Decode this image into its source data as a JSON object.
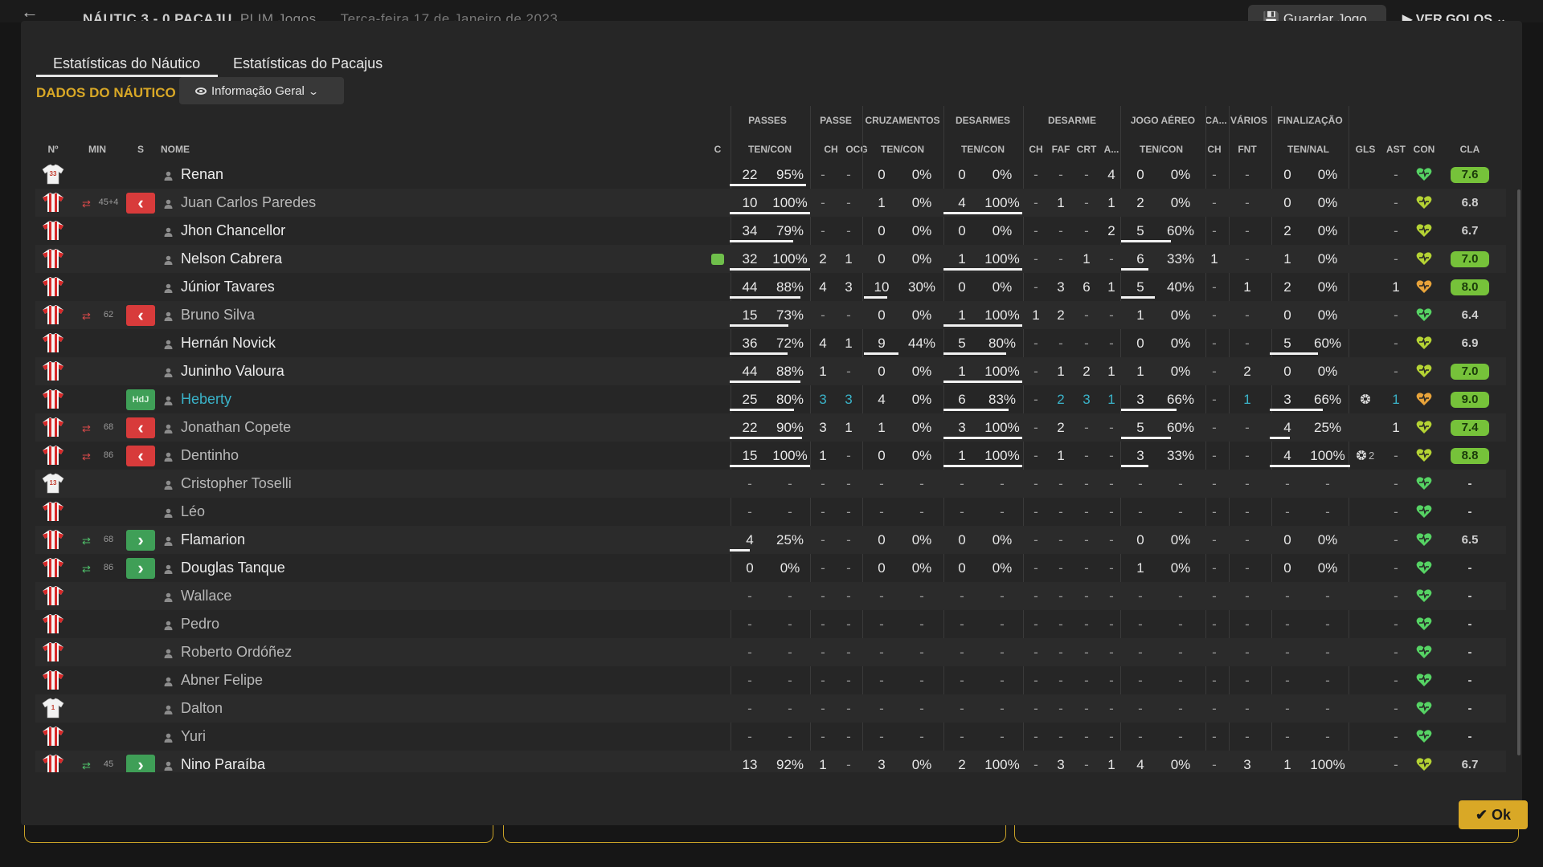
{
  "header": {
    "match": "NÁUTIC 3 - 0 PACAJU",
    "competition": "PLIM Jogos",
    "date": "Terça-feira 17 de Janeiro de 2023",
    "save_label": "Guardar Jogo",
    "goals_label": "VER GOLOS"
  },
  "tabs": [
    {
      "label": "Estatísticas do Náutico",
      "active": true
    },
    {
      "label": "Estatísticas do Pacajus",
      "active": false
    }
  ],
  "section_title": "DADOS DO NÁUTICO",
  "view_selector": "Informação Geral",
  "group_headers": [
    "PASSES",
    "PASSE",
    "CRUZAMENTOS",
    "DESARMES",
    "DESARME",
    "JOGO AÉREO",
    "CA...",
    "VÁRIOS",
    "FINALIZAÇÃO"
  ],
  "col_headers": {
    "num": "Nº",
    "min": "MIN",
    "s": "S",
    "name": "NOME",
    "c": "C",
    "passes": "TEN/CON",
    "pch": "CH",
    "pocg": "OCG",
    "cruz": "TEN/CON",
    "des": "TEN/CON",
    "dch": "CH",
    "dfaf": "FAF",
    "dcrt": "CRT",
    "da": "A...",
    "air": "TEN/CON",
    "cach": "CH",
    "fnt": "FNT",
    "fin": "TEN/NAL",
    "gls": "GLS",
    "ast": "AST",
    "con": "CON",
    "cla": "CLA"
  },
  "players": [
    {
      "name": "Renan",
      "shirt": "gk",
      "num": "33",
      "min": "",
      "sub": "",
      "swap": "",
      "c": false,
      "pt": "22",
      "pp": "95%",
      "pch": "-",
      "pocg": "-",
      "ct": "0",
      "cp": "0%",
      "dt": "0",
      "dp": "0%",
      "dch": "-",
      "dfaf": "-",
      "dcrt": "-",
      "da": "4",
      "at": "0",
      "ap": "0%",
      "cach": "-",
      "fnt": "-",
      "ft": "0",
      "fp": "0%",
      "gls": "",
      "ast": "-",
      "con": "green",
      "cla": "7.6",
      "cla_style": "green",
      "bars": {
        "pass": 0.95,
        "cruz": 0,
        "des": 0,
        "air": 0,
        "fin": 0
      }
    },
    {
      "name": "Juan Carlos Paredes",
      "shirt": "red",
      "num": "",
      "min": "45+4",
      "sub": "out",
      "swap": "red",
      "c": false,
      "pt": "10",
      "pp": "100%",
      "pch": "-",
      "pocg": "-",
      "ct": "1",
      "cp": "0%",
      "dt": "4",
      "dp": "100%",
      "dch": "-",
      "dfaf": "1",
      "dcrt": "-",
      "da": "1",
      "at": "2",
      "ap": "0%",
      "cach": "-",
      "fnt": "-",
      "ft": "0",
      "fp": "0%",
      "gls": "",
      "ast": "-",
      "con": "yellow",
      "cla": "6.8",
      "cla_style": "plain",
      "dim": true,
      "bars": {
        "pass": 1,
        "cruz": 0,
        "des": 1,
        "air": 0,
        "fin": 0
      }
    },
    {
      "name": "Jhon Chancellor",
      "shirt": "red",
      "num": "",
      "min": "",
      "sub": "",
      "swap": "",
      "c": false,
      "pt": "34",
      "pp": "79%",
      "pch": "-",
      "pocg": "-",
      "ct": "0",
      "cp": "0%",
      "dt": "0",
      "dp": "0%",
      "dch": "-",
      "dfaf": "-",
      "dcrt": "-",
      "da": "2",
      "at": "5",
      "ap": "60%",
      "cach": "-",
      "fnt": "-",
      "ft": "2",
      "fp": "0%",
      "gls": "",
      "ast": "-",
      "con": "yellow",
      "cla": "6.7",
      "cla_style": "plain",
      "bars": {
        "pass": 0.79,
        "cruz": 0,
        "des": 0,
        "air": 0.6,
        "fin": 0
      }
    },
    {
      "name": "Nelson Cabrera",
      "shirt": "red",
      "num": "",
      "min": "",
      "sub": "",
      "swap": "",
      "c": true,
      "pt": "32",
      "pp": "100%",
      "pch": "2",
      "pocg": "1",
      "ct": "0",
      "cp": "0%",
      "dt": "1",
      "dp": "100%",
      "dch": "-",
      "dfaf": "-",
      "dcrt": "1",
      "da": "-",
      "at": "6",
      "ap": "33%",
      "cach": "1",
      "fnt": "-",
      "ft": "1",
      "fp": "0%",
      "gls": "",
      "ast": "-",
      "con": "yellow",
      "cla": "7.0",
      "cla_style": "green",
      "bars": {
        "pass": 1,
        "cruz": 0,
        "des": 1,
        "air": 0.33,
        "fin": 0
      }
    },
    {
      "name": "Júnior Tavares",
      "shirt": "red",
      "num": "",
      "min": "",
      "sub": "",
      "swap": "",
      "c": false,
      "pt": "44",
      "pp": "88%",
      "pch": "4",
      "pocg": "3",
      "ct": "10",
      "cp": "30%",
      "dt": "0",
      "dp": "0%",
      "dch": "-",
      "dfaf": "3",
      "dcrt": "6",
      "da": "1",
      "at": "5",
      "ap": "40%",
      "cach": "-",
      "fnt": "1",
      "ft": "2",
      "fp": "0%",
      "gls": "",
      "ast": "1",
      "con": "orange",
      "cla": "8.0",
      "cla_style": "green",
      "bars": {
        "pass": 0.88,
        "cruz": 0.3,
        "des": 0,
        "air": 0.4,
        "fin": 0
      }
    },
    {
      "name": "Bruno Silva",
      "shirt": "red",
      "num": "",
      "min": "62",
      "sub": "out",
      "swap": "red",
      "c": false,
      "pt": "15",
      "pp": "73%",
      "pch": "-",
      "pocg": "-",
      "ct": "0",
      "cp": "0%",
      "dt": "1",
      "dp": "100%",
      "dch": "1",
      "dfaf": "2",
      "dcrt": "-",
      "da": "-",
      "at": "1",
      "ap": "0%",
      "cach": "-",
      "fnt": "-",
      "ft": "0",
      "fp": "0%",
      "gls": "",
      "ast": "-",
      "con": "green",
      "cla": "6.4",
      "cla_style": "plain",
      "dim": true,
      "bars": {
        "pass": 0.73,
        "cruz": 0,
        "des": 1,
        "air": 0,
        "fin": 0
      }
    },
    {
      "name": "Hernán Novick",
      "shirt": "red",
      "num": "",
      "min": "",
      "sub": "",
      "swap": "",
      "c": false,
      "pt": "36",
      "pp": "72%",
      "pch": "4",
      "pocg": "1",
      "ct": "9",
      "cp": "44%",
      "dt": "5",
      "dp": "80%",
      "dch": "-",
      "dfaf": "-",
      "dcrt": "-",
      "da": "-",
      "at": "0",
      "ap": "0%",
      "cach": "-",
      "fnt": "-",
      "ft": "5",
      "fp": "60%",
      "gls": "",
      "ast": "-",
      "con": "yellow",
      "cla": "6.9",
      "cla_style": "plain",
      "bars": {
        "pass": 0.72,
        "cruz": 0.44,
        "des": 0.8,
        "air": 0,
        "fin": 0.6
      }
    },
    {
      "name": "Juninho Valoura",
      "shirt": "red",
      "num": "",
      "min": "",
      "sub": "",
      "swap": "",
      "c": false,
      "pt": "44",
      "pp": "88%",
      "pch": "1",
      "pocg": "-",
      "ct": "0",
      "cp": "0%",
      "dt": "1",
      "dp": "100%",
      "dch": "-",
      "dfaf": "1",
      "dcrt": "2",
      "da": "1",
      "at": "1",
      "ap": "0%",
      "cach": "-",
      "fnt": "2",
      "ft": "0",
      "fp": "0%",
      "gls": "",
      "ast": "-",
      "con": "yellow",
      "cla": "7.0",
      "cla_style": "green",
      "bars": {
        "pass": 0.88,
        "cruz": 0,
        "des": 1,
        "air": 0,
        "fin": 0
      }
    },
    {
      "name": "Heberty",
      "shirt": "red",
      "num": "",
      "min": "",
      "sub": "hdj",
      "swap": "",
      "c": false,
      "pt": "25",
      "pp": "80%",
      "pch": "3",
      "pocg": "3",
      "ct": "4",
      "cp": "0%",
      "dt": "6",
      "dp": "83%",
      "dch": "-",
      "dfaf": "2",
      "dcrt": "3",
      "da": "1",
      "at": "3",
      "ap": "66%",
      "cach": "-",
      "fnt": "1",
      "ft": "3",
      "fp": "66%",
      "gls": "ball",
      "ast": "1",
      "con": "orange",
      "cla": "9.0",
      "cla_style": "green",
      "teal": true,
      "bars": {
        "pass": 0.8,
        "cruz": 0,
        "des": 0.83,
        "air": 0.66,
        "fin": 0.66
      }
    },
    {
      "name": "Jonathan Copete",
      "shirt": "red",
      "num": "",
      "min": "68",
      "sub": "out",
      "swap": "red",
      "c": false,
      "pt": "22",
      "pp": "90%",
      "pch": "3",
      "pocg": "1",
      "ct": "1",
      "cp": "0%",
      "dt": "3",
      "dp": "100%",
      "dch": "-",
      "dfaf": "2",
      "dcrt": "-",
      "da": "-",
      "at": "5",
      "ap": "60%",
      "cach": "-",
      "fnt": "-",
      "ft": "4",
      "fp": "25%",
      "gls": "",
      "ast": "1",
      "con": "yellow",
      "cla": "7.4",
      "cla_style": "green",
      "dim": true,
      "bars": {
        "pass": 0.9,
        "cruz": 0,
        "des": 1,
        "air": 0.6,
        "fin": 0.25
      }
    },
    {
      "name": "Dentinho",
      "shirt": "red",
      "num": "",
      "min": "86",
      "sub": "out",
      "swap": "red",
      "c": false,
      "pt": "15",
      "pp": "100%",
      "pch": "1",
      "pocg": "-",
      "ct": "0",
      "cp": "0%",
      "dt": "1",
      "dp": "100%",
      "dch": "-",
      "dfaf": "1",
      "dcrt": "-",
      "da": "-",
      "at": "3",
      "ap": "33%",
      "cach": "-",
      "fnt": "-",
      "ft": "4",
      "fp": "100%",
      "gls": "ball2",
      "ast": "-",
      "con": "yellow",
      "cla": "8.8",
      "cla_style": "green",
      "dim": true,
      "bars": {
        "pass": 1,
        "cruz": 0,
        "des": 1,
        "air": 0.33,
        "fin": 1
      }
    },
    {
      "name": "Cristopher Toselli",
      "shirt": "gk",
      "num": "13",
      "min": "",
      "sub": "",
      "swap": "",
      "c": false,
      "empty": true,
      "con": "green",
      "cla": "-",
      "cla_style": "plain",
      "dim": true
    },
    {
      "name": "Léo",
      "shirt": "red",
      "num": "",
      "min": "",
      "sub": "",
      "swap": "",
      "c": false,
      "empty": true,
      "con": "green",
      "cla": "-",
      "cla_style": "plain",
      "dim": true
    },
    {
      "name": "Flamarion",
      "shirt": "red",
      "num": "",
      "min": "68",
      "sub": "in",
      "swap": "green",
      "c": false,
      "pt": "4",
      "pp": "25%",
      "pch": "-",
      "pocg": "-",
      "ct": "0",
      "cp": "0%",
      "dt": "0",
      "dp": "0%",
      "dch": "-",
      "dfaf": "-",
      "dcrt": "-",
      "da": "-",
      "at": "0",
      "ap": "0%",
      "cach": "-",
      "fnt": "-",
      "ft": "0",
      "fp": "0%",
      "gls": "",
      "ast": "-",
      "con": "green",
      "cla": "6.5",
      "cla_style": "plain",
      "bars": {
        "pass": 0.25,
        "cruz": 0,
        "des": 0,
        "air": 0,
        "fin": 0
      }
    },
    {
      "name": "Douglas Tanque",
      "shirt": "red",
      "num": "",
      "min": "86",
      "sub": "in",
      "swap": "green",
      "c": false,
      "pt": "0",
      "pp": "0%",
      "pch": "-",
      "pocg": "-",
      "ct": "0",
      "cp": "0%",
      "dt": "0",
      "dp": "0%",
      "dch": "-",
      "dfaf": "-",
      "dcrt": "-",
      "da": "-",
      "at": "1",
      "ap": "0%",
      "cach": "-",
      "fnt": "-",
      "ft": "0",
      "fp": "0%",
      "gls": "",
      "ast": "-",
      "con": "green",
      "cla": "-",
      "cla_style": "plain",
      "bars": {
        "pass": 0,
        "cruz": 0,
        "des": 0,
        "air": 0,
        "fin": 0
      }
    },
    {
      "name": "Wallace",
      "shirt": "red",
      "num": "",
      "min": "",
      "sub": "",
      "swap": "",
      "c": false,
      "empty": true,
      "con": "green",
      "cla": "-",
      "cla_style": "plain",
      "dim": true
    },
    {
      "name": "Pedro",
      "shirt": "red",
      "num": "",
      "min": "",
      "sub": "",
      "swap": "",
      "c": false,
      "empty": true,
      "con": "green",
      "cla": "-",
      "cla_style": "plain",
      "dim": true
    },
    {
      "name": "Roberto Ordóñez",
      "shirt": "red",
      "num": "",
      "min": "",
      "sub": "",
      "swap": "",
      "c": false,
      "empty": true,
      "con": "green",
      "cla": "-",
      "cla_style": "plain",
      "dim": true
    },
    {
      "name": "Abner Felipe",
      "shirt": "red",
      "num": "",
      "min": "",
      "sub": "",
      "swap": "",
      "c": false,
      "empty": true,
      "con": "green",
      "cla": "-",
      "cla_style": "plain",
      "dim": true
    },
    {
      "name": "Dalton",
      "shirt": "gk",
      "num": "1",
      "min": "",
      "sub": "",
      "swap": "",
      "c": false,
      "empty": true,
      "con": "green",
      "cla": "-",
      "cla_style": "plain",
      "dim": true
    },
    {
      "name": "Yuri",
      "shirt": "red",
      "num": "",
      "min": "",
      "sub": "",
      "swap": "",
      "c": false,
      "empty": true,
      "con": "green",
      "cla": "-",
      "cla_style": "plain",
      "dim": true
    },
    {
      "name": "Nino Paraíba",
      "shirt": "red",
      "num": "",
      "min": "45",
      "sub": "in",
      "swap": "green",
      "c": false,
      "pt": "13",
      "pp": "92%",
      "pch": "1",
      "pocg": "-",
      "ct": "3",
      "cp": "0%",
      "dt": "2",
      "dp": "100%",
      "dch": "-",
      "dfaf": "3",
      "dcrt": "-",
      "da": "1",
      "at": "4",
      "ap": "0%",
      "cach": "-",
      "fnt": "3",
      "ft": "1",
      "fp": "100%",
      "gls": "",
      "ast": "-",
      "con": "yellow",
      "cla": "6.7",
      "cla_style": "plain",
      "bars": {
        "pass": 0.92,
        "cruz": 0,
        "des": 1,
        "air": 0,
        "fin": 1
      }
    }
  ],
  "ok_label": "Ok",
  "colors": {
    "accent": "#d9a826",
    "green": "#76c23a",
    "red": "#d83b3b",
    "teal": "#3ab3c9"
  }
}
